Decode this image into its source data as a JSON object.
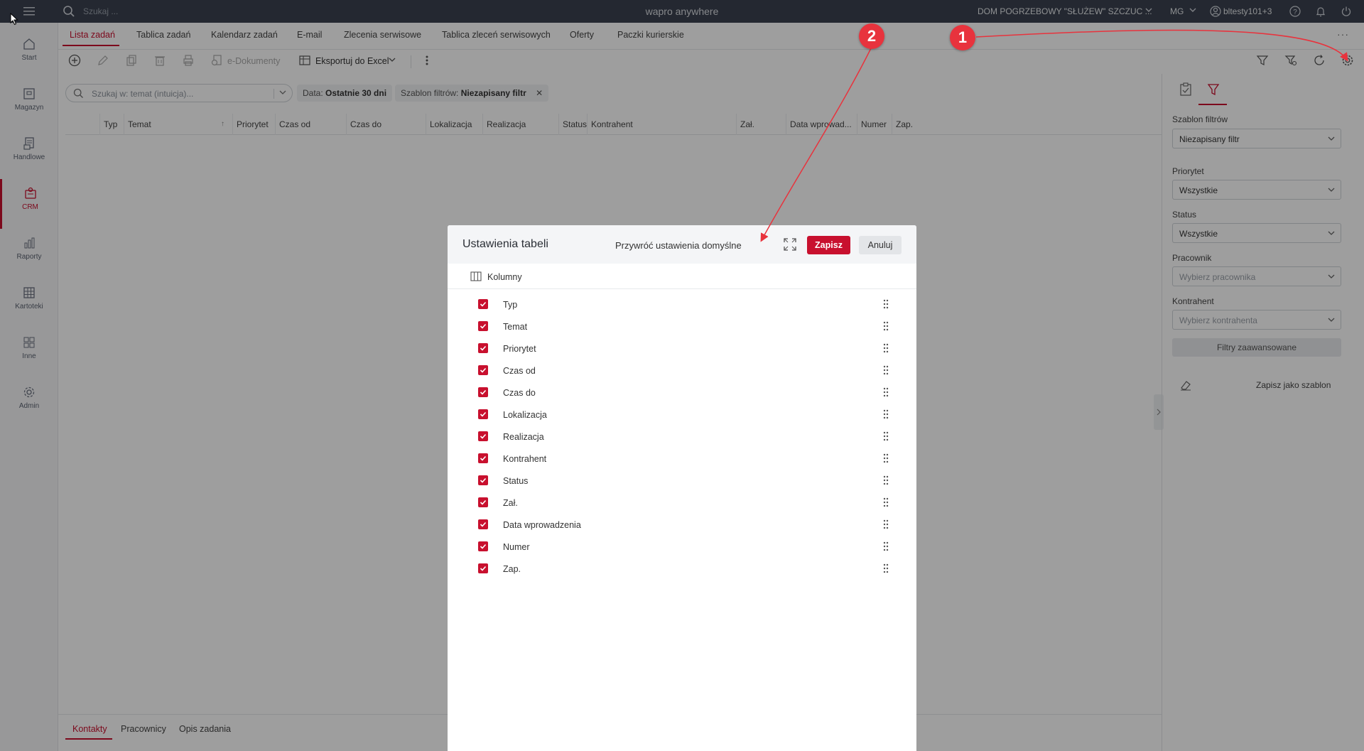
{
  "topbar": {
    "search_placeholder": "Szukaj ...",
    "app_title": "wapro anywhere",
    "company": "DOM POGRZEBOWY \"SŁUŻEW\" SZCZUC ...",
    "user_initials": "MG",
    "user_name": "bltesty101+3"
  },
  "leftnav": {
    "items": [
      {
        "label": "Start",
        "icon": "home-icon"
      },
      {
        "label": "Magazyn",
        "icon": "warehouse-icon"
      },
      {
        "label": "Handlowe",
        "icon": "invoice-icon"
      },
      {
        "label": "CRM",
        "icon": "crm-icon",
        "active": true
      },
      {
        "label": "Raporty",
        "icon": "chart-icon"
      },
      {
        "label": "Kartoteki",
        "icon": "table-icon"
      },
      {
        "label": "Inne",
        "icon": "grid-icon"
      },
      {
        "label": "Admin",
        "icon": "gear-icon"
      }
    ]
  },
  "tabs": [
    {
      "label": "Lista zadań",
      "active": true
    },
    {
      "label": "Tablica zadań"
    },
    {
      "label": "Kalendarz zadań"
    },
    {
      "label": "E-mail"
    },
    {
      "label": "Zlecenia serwisowe"
    },
    {
      "label": "Tablica zleceń serwisowych"
    },
    {
      "label": "Oferty"
    },
    {
      "label": "Paczki kurierskie"
    }
  ],
  "toolbar": {
    "edocs_label": "e-Dokumenty",
    "excel_label": "Eksportuj do Excel"
  },
  "filterbar": {
    "search_placeholder": "Szukaj w: temat (intuicja)...",
    "date_chip_label": "Data:",
    "date_chip_value": "Ostatnie 30 dni",
    "template_chip_label": "Szablon filtrów:",
    "template_chip_value": "Niezapisany filtr"
  },
  "grid": {
    "columns": [
      "Typ",
      "Temat",
      "Priorytet",
      "Czas od",
      "Czas do",
      "Lokalizacja",
      "Realizacja",
      "Status",
      "Kontrahent",
      "Zał.",
      "Data wprowad...",
      "Numer",
      "Zap."
    ]
  },
  "bottom_tabs": [
    {
      "label": "Kontakty",
      "active": true
    },
    {
      "label": "Pracownicy"
    },
    {
      "label": "Opis zadania"
    }
  ],
  "right_panel": {
    "template_label": "Szablon filtrów",
    "template_value": "Niezapisany filtr",
    "priority_label": "Priorytet",
    "priority_value": "Wszystkie",
    "status_label": "Status",
    "status_value": "Wszystkie",
    "employee_label": "Pracownik",
    "employee_placeholder": "Wybierz pracownika",
    "contractor_label": "Kontrahent",
    "contractor_placeholder": "Wybierz kontrahenta",
    "advanced_filters": "Filtry zaawansowane",
    "save_as_template": "Zapisz jako szablon"
  },
  "modal": {
    "title": "Ustawienia tabeli",
    "restore_defaults": "Przywróć ustawienia domyślne",
    "save_label": "Zapisz",
    "cancel_label": "Anuluj",
    "section_label": "Kolumny",
    "columns": [
      {
        "name": "Typ",
        "checked": true
      },
      {
        "name": "Temat",
        "checked": true
      },
      {
        "name": "Priorytet",
        "checked": true
      },
      {
        "name": "Czas od",
        "checked": true
      },
      {
        "name": "Czas do",
        "checked": true
      },
      {
        "name": "Lokalizacja",
        "checked": true
      },
      {
        "name": "Realizacja",
        "checked": true
      },
      {
        "name": "Kontrahent",
        "checked": true
      },
      {
        "name": "Status",
        "checked": true
      },
      {
        "name": "Zał.",
        "checked": true
      },
      {
        "name": "Data wprowadzenia",
        "checked": true
      },
      {
        "name": "Numer",
        "checked": true
      },
      {
        "name": "Zap.",
        "checked": true
      }
    ]
  },
  "annotations": {
    "marker_1": "1",
    "marker_2": "2",
    "color": "#e8333d"
  },
  "colors": {
    "accent": "#c8102e",
    "topbar": "#3a4250"
  }
}
